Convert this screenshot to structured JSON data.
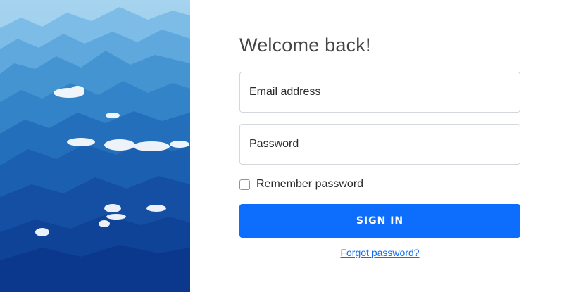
{
  "hero": {
    "image": "mountain-landscape-with-clouds",
    "colors": {
      "sky": "#8ec8ea",
      "mid": "#2f7fc6",
      "deep": "#0c3a8e"
    }
  },
  "login": {
    "title": "Welcome back!",
    "email": {
      "value": "",
      "placeholder": "Email address"
    },
    "password": {
      "value": "",
      "placeholder": "Password"
    },
    "remember": {
      "label": "Remember password",
      "checked": false
    },
    "signin_label": "SIGN IN",
    "forgot_label": "Forgot password?"
  },
  "colors": {
    "accent": "#0d6efd",
    "text": "#2b2b2b",
    "border": "#d4d7dc"
  }
}
